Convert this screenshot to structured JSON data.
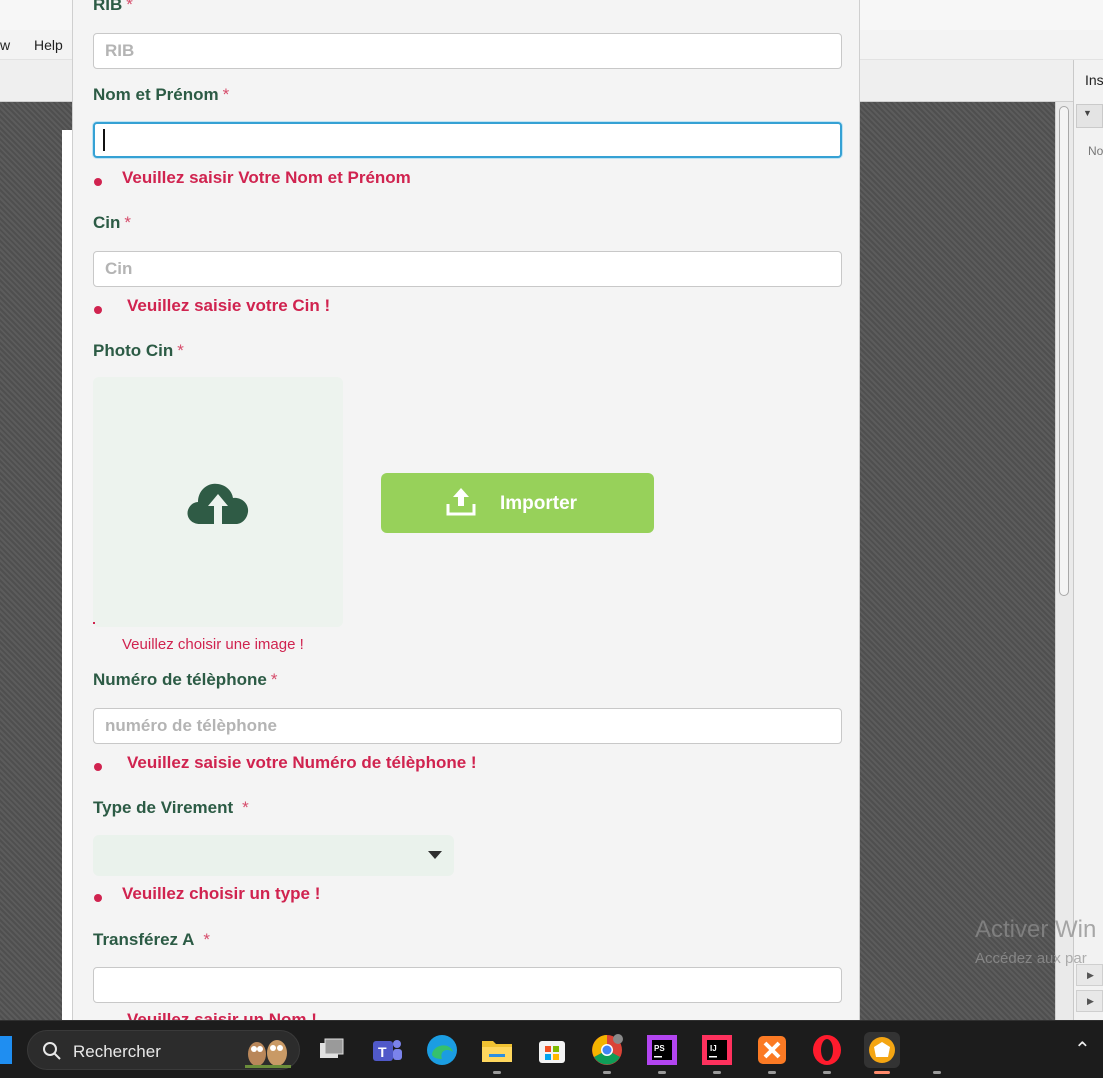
{
  "background_app": {
    "menu": [
      {
        "label": "w"
      },
      {
        "label": "Help"
      }
    ],
    "right_panel": {
      "title": "Ins",
      "text": "No"
    },
    "watermark": {
      "line1": "Activer Win",
      "line2": "Accédez aux par"
    }
  },
  "form": {
    "rib": {
      "label": "RIB",
      "placeholder": "RIB",
      "value": ""
    },
    "nom": {
      "label": "Nom et Prénom",
      "value": "",
      "error": "Veuillez saisir Votre Nom et Prénom"
    },
    "cin": {
      "label": "Cin",
      "placeholder": "Cin",
      "value": "",
      "error": "Veuillez saisie votre Cin  !"
    },
    "photo": {
      "label": "Photo Cin",
      "error": "Veuillez choisir une image !",
      "import_button": "Importer"
    },
    "telephone": {
      "label": "Numéro de télèphone",
      "placeholder": "numéro de télèphone",
      "value": "",
      "error": "Veuillez saisie votre Numéro de télèphone !"
    },
    "type_virement": {
      "label": "Type de Virement",
      "selected": "",
      "error": "Veuillez choisir un type !"
    },
    "transferez": {
      "label": "Transférez A",
      "value": "",
      "error_partial": "Veuillez saisir un Nom !"
    },
    "required_marker": "*"
  },
  "taskbar": {
    "search_label": "Rechercher",
    "apps": [
      "task-view",
      "teams",
      "edge",
      "file-explorer",
      "store",
      "chrome",
      "phpstorm",
      "intellij",
      "xampp",
      "opera",
      "app-active"
    ]
  }
}
